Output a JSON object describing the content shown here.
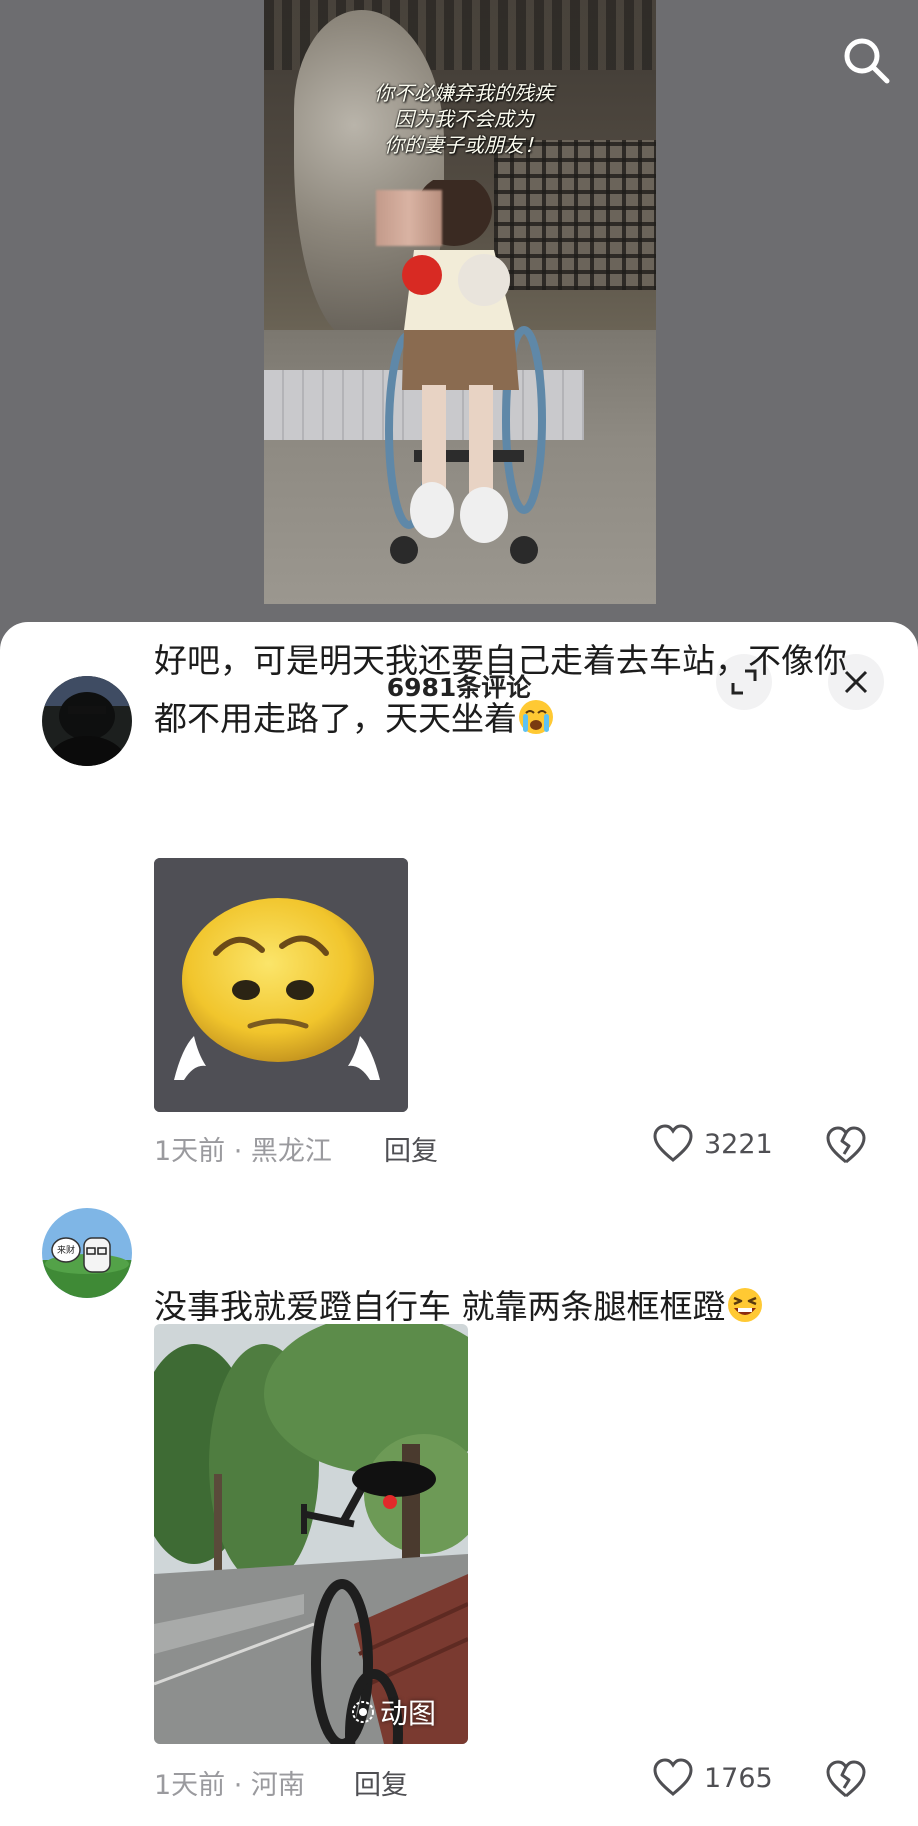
{
  "video": {
    "caption_lines": [
      "你不必嫌弃我的残疾",
      "因为我不会成为",
      "你的妻子或朋友！"
    ],
    "search_icon": "search-icon"
  },
  "sheet": {
    "title": "6981条评论",
    "expand_icon": "expand-icon",
    "close_icon": "close-icon"
  },
  "comments": [
    {
      "text": "好吧，可是明天我还要自己走着去车站，不像你都不用走路了，天天坐着",
      "emoji": "crying-face-emoji",
      "media": "sad-emoji-sticker",
      "meta": "1天前 · 黑龙江",
      "reply": "回复",
      "likes": "3221"
    },
    {
      "text": "没事我就爱蹬自行车 就靠两条腿框框蹬",
      "emoji": "laughing-face-emoji",
      "media": "bicycle-photo",
      "gif_label": "动图",
      "avatar_text": "来财",
      "meta": "1天前 · 河南",
      "reply": "回复",
      "likes": "1765"
    }
  ],
  "colors": {
    "backdrop": "#6e6e71",
    "sheet": "#ffffff",
    "meta_text": "#9a9a9e",
    "body_text": "#1c1c1c"
  }
}
